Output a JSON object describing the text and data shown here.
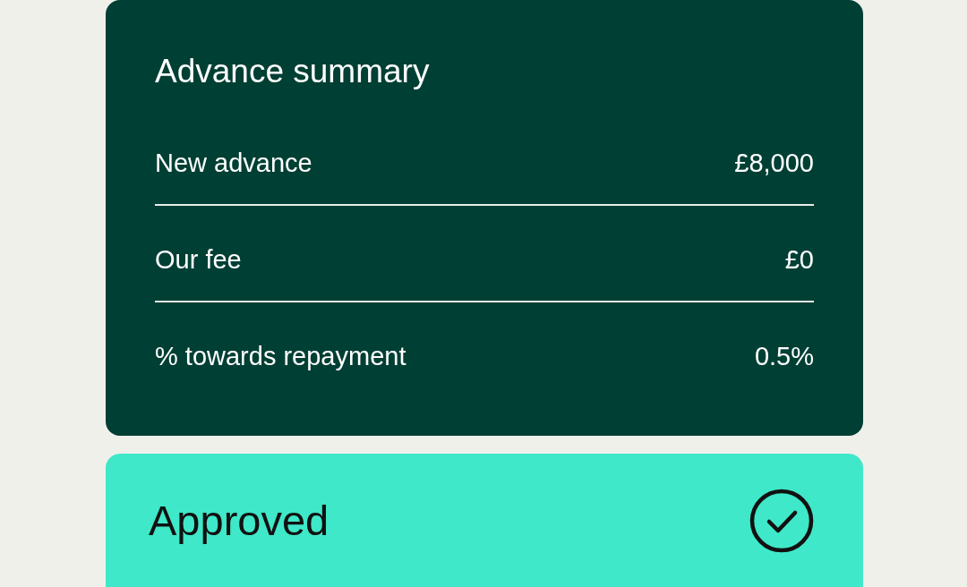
{
  "summary": {
    "title": "Advance summary",
    "rows": [
      {
        "label": "New advance",
        "value": "£8,000"
      },
      {
        "label": "Our fee",
        "value": "£0"
      },
      {
        "label": "% towards repayment",
        "value": "0.5%"
      }
    ]
  },
  "status": {
    "label": "Approved"
  }
}
